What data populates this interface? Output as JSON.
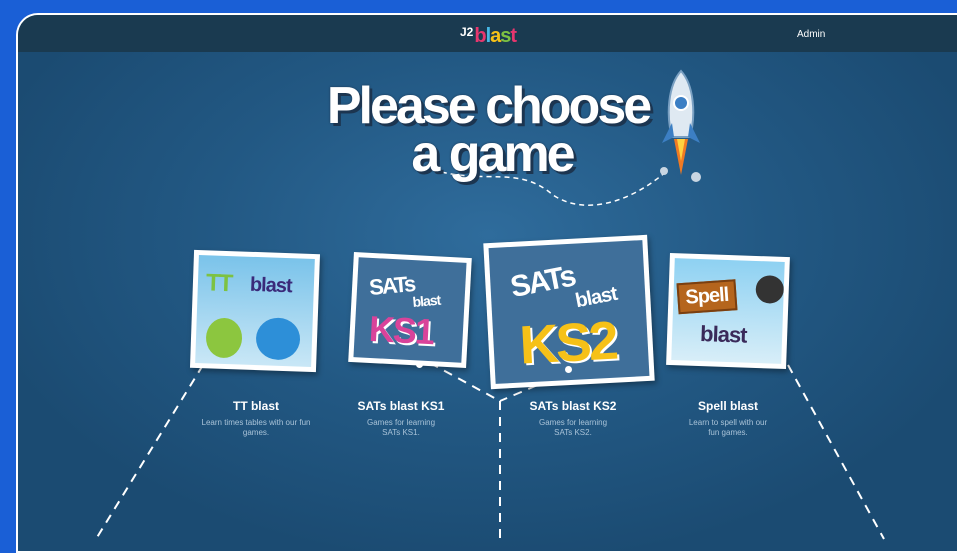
{
  "header": {
    "logo_prefix": "J2",
    "logo_letters": [
      "b",
      "l",
      "a",
      "s",
      "t"
    ],
    "logo_colors": [
      "#e7366e",
      "#46b8e6",
      "#f6c118",
      "#7dc242",
      "#e7366e"
    ],
    "admin_label": "Admin"
  },
  "headline": {
    "line1": "Please choose",
    "line2": "a game"
  },
  "games": [
    {
      "title": "TT blast",
      "desc": "Learn times tables with our fun games.",
      "art_title": "TT",
      "art_word": "blast"
    },
    {
      "title": "SATs blast KS1",
      "desc": "Games for learning SATs KS1.",
      "art_title": "SATs",
      "art_word": "blast",
      "art_level": "KS1",
      "level_color": "#d9439a"
    },
    {
      "title": "SATs blast KS2",
      "desc": "Games for learning SATs KS2.",
      "art_title": "SATs",
      "art_word": "blast",
      "art_level": "KS2",
      "level_color": "#f6c118"
    },
    {
      "title": "Spell blast",
      "desc": "Learn to spell with our fun games.",
      "art_title": "Spell",
      "art_word": "blast"
    }
  ],
  "colors": {
    "page_bg": "#1a5fd6",
    "topbar": "#1a3a50",
    "panel": "#225883"
  }
}
